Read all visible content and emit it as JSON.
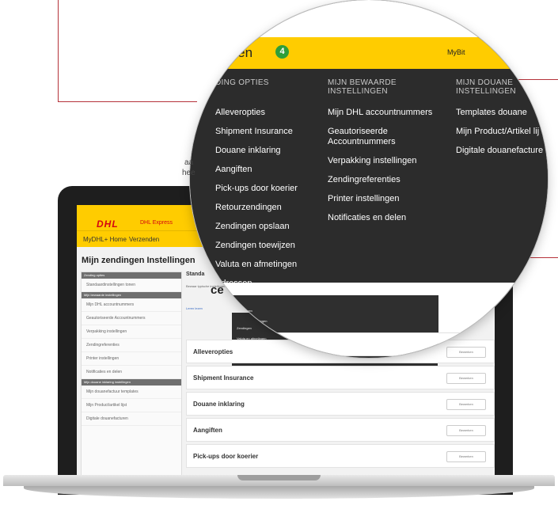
{
  "laptop": {
    "logo": "DHL",
    "logo_sub": "DHL Express",
    "nav": [
      "MyDHL+ Home",
      "Verzenden"
    ],
    "page_title": "Mijn zendingen Instellingen",
    "sidebar": [
      {
        "type": "group",
        "label": "Zending opties"
      },
      {
        "type": "item",
        "label": "Standaardinstellingen tonen"
      },
      {
        "type": "group",
        "label": "Mijn bewaarde instellingen"
      },
      {
        "type": "item",
        "label": "Mijn DHL accountnummers"
      },
      {
        "type": "item",
        "label": "Geautoriseerde Accountnummers"
      },
      {
        "type": "item",
        "label": "Verpakking instellingen"
      },
      {
        "type": "item",
        "label": "Zendingreferenties"
      },
      {
        "type": "item",
        "label": "Printer instellingen"
      },
      {
        "type": "item",
        "label": "Notificaties en delen"
      },
      {
        "type": "group",
        "label": "Mijn douane inklaring instellingen"
      },
      {
        "type": "item",
        "label": "Mijn douanefactuur templates"
      },
      {
        "type": "item",
        "label": "Mijn Product/artikel lijst"
      },
      {
        "type": "item",
        "label": "Digitale douanefacturen"
      }
    ],
    "main_heading": "Standa",
    "main_big": "ce",
    "main_sub": "Bewaar typische instellingen en ontvang een factuur die u kunt",
    "main_link": "Leren lezen",
    "popup_items": [
      "Zendingen",
      "Valuta en afmetingen",
      "Adressen"
    ],
    "rows": [
      {
        "label": "Alleveropties",
        "button": "Bewerken"
      },
      {
        "label": "Shipment Insurance",
        "button": "Bewerken"
      },
      {
        "label": "Douane inklaring",
        "button": "Bewerken"
      },
      {
        "label": "Aangiften",
        "button": "Bewerken"
      },
      {
        "label": "Pick-ups door koerier",
        "button": "Bewerken"
      }
    ]
  },
  "zoom": {
    "bar_title_fragment": "eren",
    "badge_count": "4",
    "mybit": "MyBit",
    "columns": [
      {
        "header": "DING OPTIES",
        "items": [
          "Alleveropties",
          "Shipment Insurance",
          "Douane inklaring",
          "Aangiften",
          "Pick-ups door koerier",
          "Retourzendingen",
          "Zendingen opslaan",
          "Zendingen toewijzen",
          "Valuta en afmetingen",
          "Adressen"
        ]
      },
      {
        "header": "MIJN BEWAARDE INSTELLINGEN",
        "items": [
          "Mijn DHL accountnummers",
          "Geautoriseerde Accountnummers",
          "Verpakking instellingen",
          "Zendingreferenties",
          "Printer instellingen",
          "Notificaties en delen"
        ]
      },
      {
        "header": "MIJN DOUANE INSTELLINGEN",
        "items": [
          "Templates douane",
          "Mijn Product/Artikel lij",
          "Digitale douanefacture"
        ]
      }
    ],
    "below_title": "ce",
    "below_sub": "Bewaar typische instellingen",
    "below_link": "Leren lezen",
    "popup_items": [
      "Zendingen",
      "Valuta en afmetingen",
      "Adressen"
    ],
    "row_label": "Alleveropties",
    "fragments": [
      "aa",
      "hee"
    ]
  },
  "colors": {
    "dhl_yellow": "#ffcc00",
    "dhl_red": "#d40511",
    "menu_dark": "#2c2c2c",
    "badge_green": "#2e9e3a",
    "callout": "#b5323a"
  }
}
